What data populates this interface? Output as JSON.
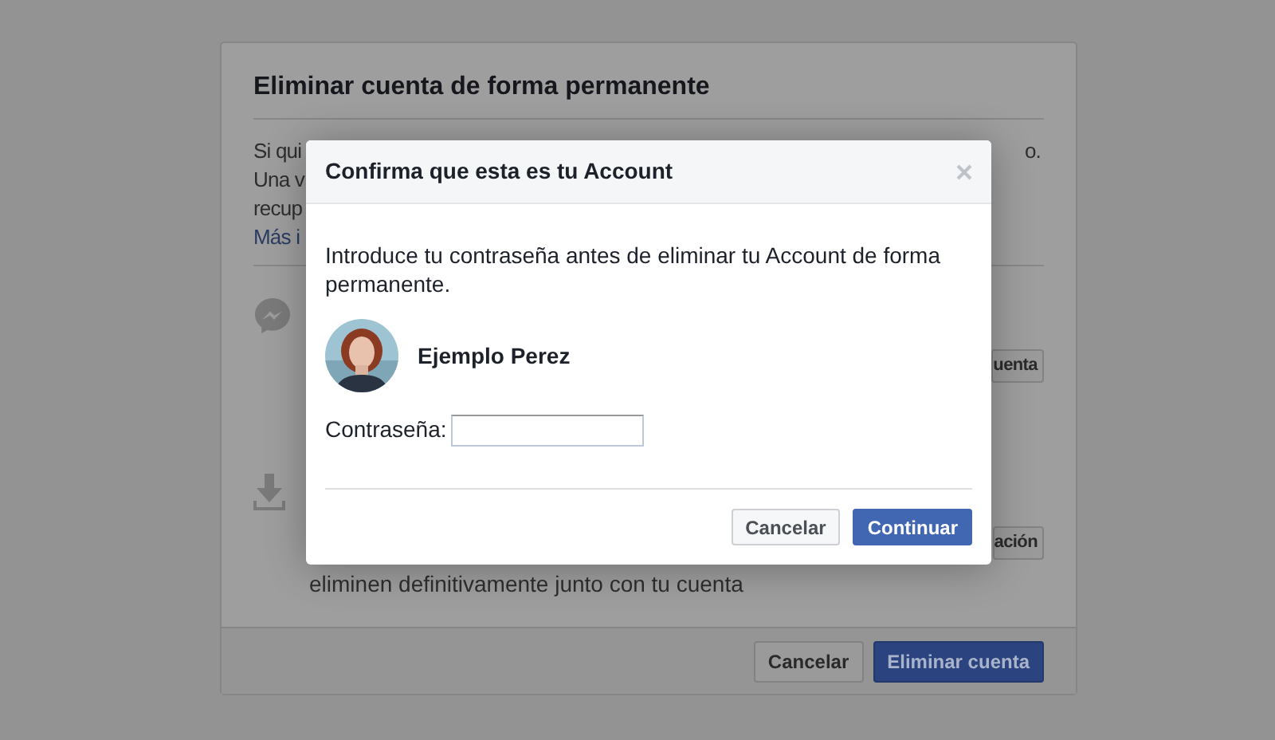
{
  "background_page": {
    "title": "Eliminar cuenta de forma permanente",
    "paragraph_lines": [
      {
        "left": "Si qui",
        "right": "o.",
        "kind": "text"
      },
      {
        "left": "Una v",
        "kind": "text"
      },
      {
        "left": "recup",
        "kind": "text"
      },
      {
        "left": "Más i",
        "kind": "link"
      }
    ],
    "sections": [
      {
        "kind": "messenger",
        "button": "uenta"
      },
      {
        "kind": "download",
        "button": "ación",
        "text": "eliminen definitivamente junto con tu cuenta"
      }
    ],
    "footer_buttons": [
      {
        "label": "Cancelar",
        "kind": "secondary"
      },
      {
        "label": "Eliminar cuenta",
        "kind": "primary"
      }
    ]
  },
  "dialog": {
    "title": "Confirma que esta es tu Account",
    "message": "Introduce tu contraseña antes de eliminar tu Account de forma permanente.",
    "user": {
      "name": "Ejemplo Perez"
    },
    "password_field": {
      "label": "Contraseña:"
    },
    "buttons": [
      {
        "label": "Cancelar",
        "kind": "secondary"
      },
      {
        "label": "Continuar",
        "kind": "primary"
      }
    ]
  }
}
